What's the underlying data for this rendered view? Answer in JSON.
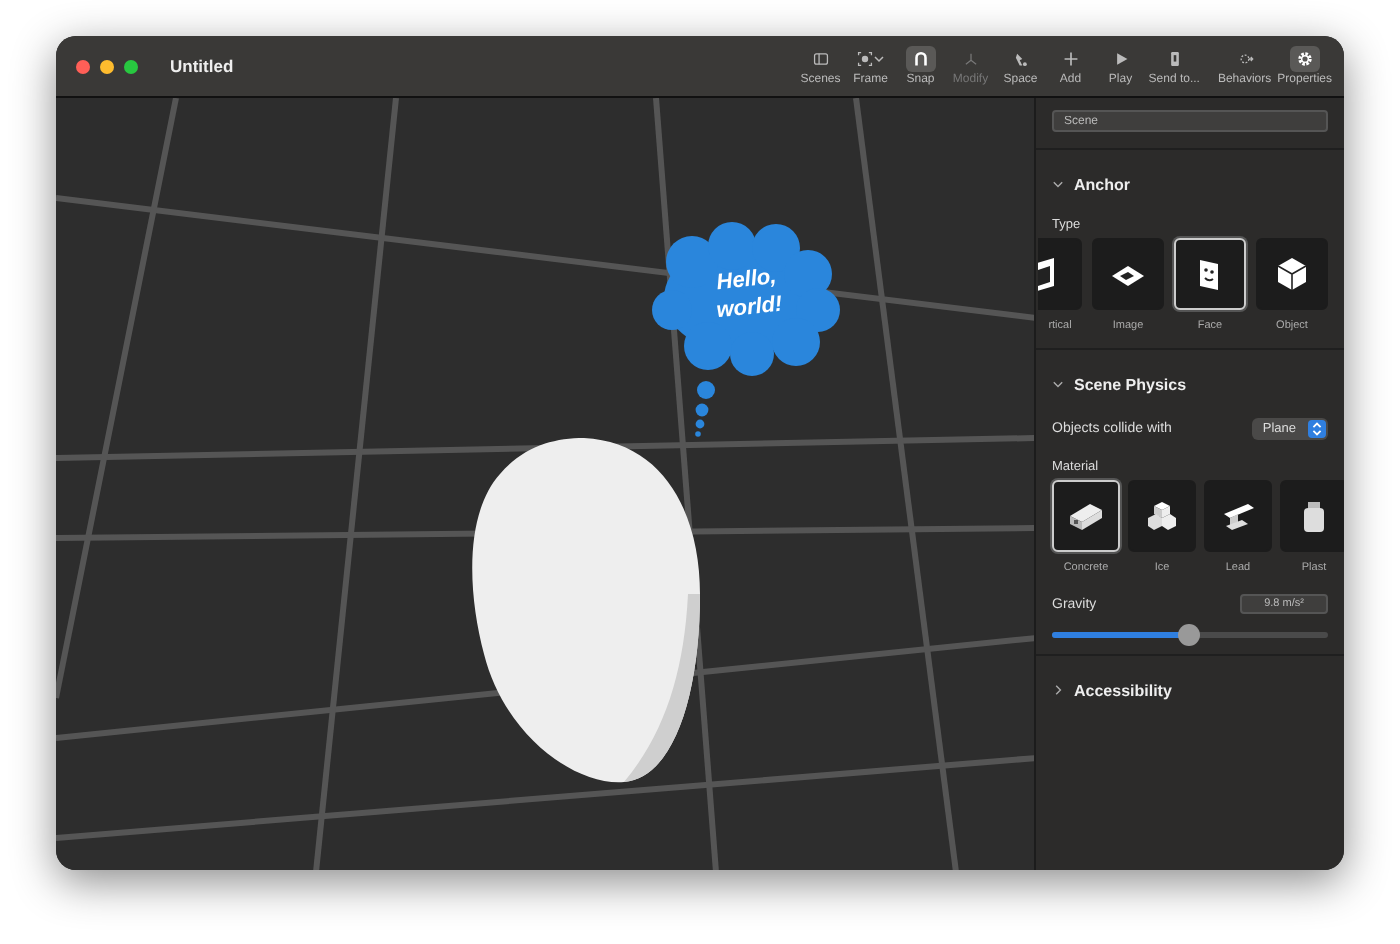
{
  "window": {
    "title": "Untitled"
  },
  "toolbar": [
    {
      "kind": "sidebar",
      "label": "Scenes",
      "selected": false,
      "disabled": false,
      "menu": false
    },
    {
      "kind": "frame",
      "label": "Frame",
      "selected": false,
      "disabled": false,
      "menu": true
    },
    {
      "kind": "magnet",
      "label": "Snap",
      "selected": true,
      "disabled": false,
      "menu": false
    },
    {
      "kind": "modify",
      "label": "Modify",
      "selected": false,
      "disabled": true,
      "menu": false
    },
    {
      "kind": "space",
      "label": "Space",
      "selected": false,
      "disabled": false,
      "menu": false
    },
    {
      "kind": "plus",
      "label": "Add",
      "selected": false,
      "disabled": false,
      "menu": false
    },
    {
      "kind": "play",
      "label": "Play",
      "selected": false,
      "disabled": false,
      "menu": false
    },
    {
      "kind": "phone",
      "label": "Send to...",
      "selected": false,
      "disabled": false,
      "menu": false
    },
    {
      "kind": "behaviors",
      "label": "Behaviors",
      "selected": false,
      "disabled": false,
      "menu": false
    },
    {
      "kind": "gear",
      "label": "Properties",
      "selected": true,
      "disabled": false,
      "menu": false
    }
  ],
  "viewport": {
    "bubble_text": "Hello, world!"
  },
  "panel": {
    "scene_name": "Scene",
    "sections": [
      {
        "kind": "anchor",
        "title": "Anchor",
        "expanded": true,
        "type_label": "Type",
        "types": [
          {
            "kind": "vertical",
            "label": "rtical",
            "selected": false
          },
          {
            "kind": "image",
            "label": "Image",
            "selected": false
          },
          {
            "kind": "face",
            "label": "Face",
            "selected": true
          },
          {
            "kind": "object",
            "label": "Object",
            "selected": false
          }
        ]
      },
      {
        "kind": "physics",
        "title": "Scene Physics",
        "expanded": true,
        "collide_label": "Objects collide with",
        "collide_value": "Plane",
        "material_label": "Material",
        "materials": [
          {
            "kind": "concrete",
            "label": "Concrete",
            "selected": true
          },
          {
            "kind": "ice",
            "label": "Ice",
            "selected": false
          },
          {
            "kind": "lead",
            "label": "Lead",
            "selected": false
          },
          {
            "kind": "plastic",
            "label": "Plast",
            "selected": false
          }
        ],
        "gravity_label": "Gravity",
        "gravity_reading": "9.8 m/s²",
        "gravity": {
          "level": 0.49
        }
      },
      {
        "kind": "plain",
        "title": "Accessibility",
        "expanded": false
      }
    ]
  }
}
